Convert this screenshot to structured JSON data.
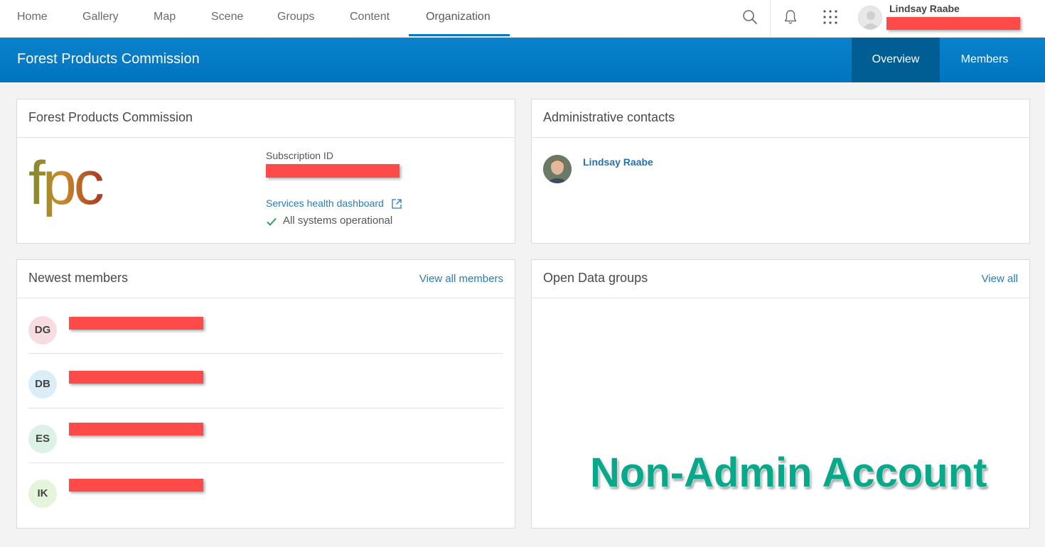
{
  "topnav": {
    "tabs": [
      {
        "label": "Home"
      },
      {
        "label": "Gallery"
      },
      {
        "label": "Map"
      },
      {
        "label": "Scene"
      },
      {
        "label": "Groups"
      },
      {
        "label": "Content"
      },
      {
        "label": "Organization"
      }
    ],
    "active_tab": "Organization",
    "icons": [
      "search-icon",
      "bell-icon",
      "apps-grid-icon"
    ],
    "user": {
      "name": "Lindsay Raabe"
    }
  },
  "band": {
    "title": "Forest Products Commission",
    "tabs": [
      {
        "label": "Overview"
      },
      {
        "label": "Members"
      }
    ],
    "active_tab": "Overview",
    "color": "#0079c1"
  },
  "org_card": {
    "title": "Forest Products Commission",
    "logo_text": "fpc",
    "subscription_label": "Subscription ID",
    "health_link": "Services health dashboard",
    "status": "All systems operational"
  },
  "admin_card": {
    "title": "Administrative contacts",
    "contact_name": "Lindsay Raabe"
  },
  "members_card": {
    "title": "Newest members",
    "link": "View all members",
    "members": [
      {
        "initials": "DG",
        "color": "#f7dde2"
      },
      {
        "initials": "DB",
        "color": "#dbeef8"
      },
      {
        "initials": "ES",
        "color": "#dcf2e6"
      },
      {
        "initials": "IK",
        "color": "#e4f5dc"
      }
    ]
  },
  "groups_card": {
    "title": "Open Data groups",
    "link": "View all"
  },
  "watermark": "Non-Admin Account",
  "colors": {
    "accent": "#0079c1",
    "link": "#2b7cb5",
    "redaction": "#ff4a4a",
    "watermark": "#0aa88a"
  }
}
